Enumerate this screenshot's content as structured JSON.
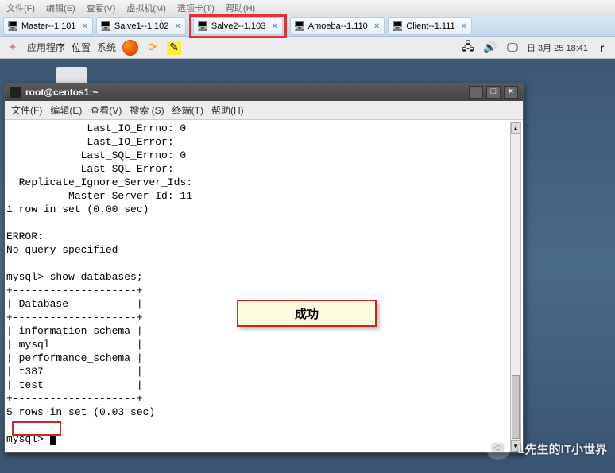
{
  "topmenu": {
    "items": [
      "文件(F)",
      "编辑(E)",
      "查看(V)",
      "虚拟机(M)",
      "选项卡(T)",
      "帮助(H)"
    ]
  },
  "tabs": [
    {
      "label": "Master--1.101",
      "highlighted": false
    },
    {
      "label": "Salve1--1.102",
      "highlighted": false
    },
    {
      "label": "Salve2--1.103",
      "highlighted": true
    },
    {
      "label": "Amoeba--1.110",
      "highlighted": false
    },
    {
      "label": "Client--1.111",
      "highlighted": false
    }
  ],
  "toolbar": {
    "apps": "应用程序",
    "places": "位置",
    "system": "系统",
    "clock": "日 3月 25 18:41"
  },
  "terminal": {
    "title": "root@centos1:~",
    "menu": [
      "文件(F)",
      "编辑(E)",
      "查看(V)",
      "搜索 (S)",
      "终端(T)",
      "帮助(H)"
    ],
    "colon": ":",
    "lines": {
      "l1": "             Last_IO_Errno: 0",
      "l2": "             Last_IO_Error:",
      "l3": "            Last_SQL_Errno: 0",
      "l4": "            Last_SQL_Error:",
      "l5": "  Replicate_Ignore_Server_Ids:",
      "l6": "          Master_Server_Id: 11",
      "l7": "1 row in set (0.00 sec)",
      "l8": "",
      "l9": "ERROR:",
      "l10": "No query specified",
      "l11": "",
      "l12": "mysql> show databases;",
      "l13": "+--------------------+",
      "l14": "| Database           |",
      "l15": "+--------------------+",
      "l16": "| information_schema |",
      "l17": "| mysql              |",
      "l18": "| performance_schema |",
      "l19": "| t387               |",
      "l20": "| test               |",
      "l21": "+--------------------+",
      "l22": "5 rows in set (0.03 sec)",
      "l23": "",
      "l24": "mysql> "
    }
  },
  "callout": {
    "text": "成功"
  },
  "watermark": {
    "text": "L先生的IT小世界"
  }
}
